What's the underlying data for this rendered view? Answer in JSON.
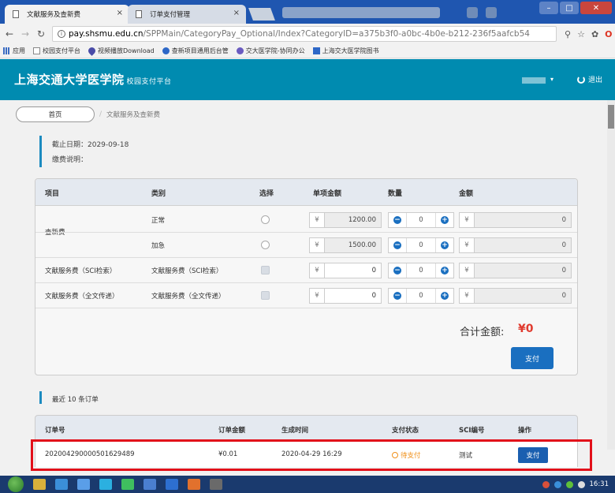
{
  "browser": {
    "tabs": [
      {
        "title": "文献服务及查新费"
      },
      {
        "title": "订单支付管理"
      }
    ],
    "url_host": "pay.shsmu.edu.cn",
    "url_path": "/SPPMain/CategoryPay_Optional/Index?CategoryID=a375b3f0-a0bc-4b0e-b212-236f5aafcb54",
    "bookmarks": [
      "应用",
      "校园支付平台",
      "视频播放Download",
      "查新项目通用后台管",
      "交大医学院-协同办公",
      "上海交大医学院图书"
    ]
  },
  "header": {
    "title": "上海交通大学医学院",
    "subtitle": "校园支付平台",
    "logout": "退出"
  },
  "breadcrumb": {
    "home": "首页",
    "current": "文献服务及查新费"
  },
  "info": {
    "deadline": "截止日期：2029-09-18",
    "payment_note": "缴费说明："
  },
  "fee_table": {
    "headers": [
      "项目",
      "类别",
      "选择",
      "单项金额",
      "数量",
      "金额"
    ],
    "group_label": "查新费",
    "rows": [
      {
        "category": "正常",
        "price": "1200.00",
        "qty": "0",
        "amount": "0"
      },
      {
        "category": "加急",
        "price": "1500.00",
        "qty": "0",
        "amount": "0"
      },
      {
        "item": "文献服务费（SCI检索）",
        "category": "文献服务费（SCI检索）",
        "price": "0",
        "qty": "0",
        "amount": "0"
      },
      {
        "item": "文献服务费（全文传递）",
        "category": "文献服务费（全文传递）",
        "price": "0",
        "qty": "0",
        "amount": "0"
      }
    ],
    "currency": "¥",
    "total_label": "合计金额:",
    "total_value": "¥0",
    "pay_button": "支付"
  },
  "orders": {
    "title": "最近 10 条订单",
    "headers": [
      "订单号",
      "订单金额",
      "生成时间",
      "支付状态",
      "SCI编号",
      "操作"
    ],
    "row": {
      "order_no": "202004290000501629489",
      "amount": "¥0.01",
      "created": "2020-04-29 16:29",
      "status": "待支付",
      "sci": "测试",
      "action": "支付"
    }
  },
  "taskbar": {
    "time": "16:31"
  },
  "colors": {
    "header_bg": "#008bb0",
    "accent_blue": "#1a6fc0",
    "total_red": "#e03a2e",
    "status_orange": "#f0901a",
    "highlight_red": "#e2101a"
  }
}
